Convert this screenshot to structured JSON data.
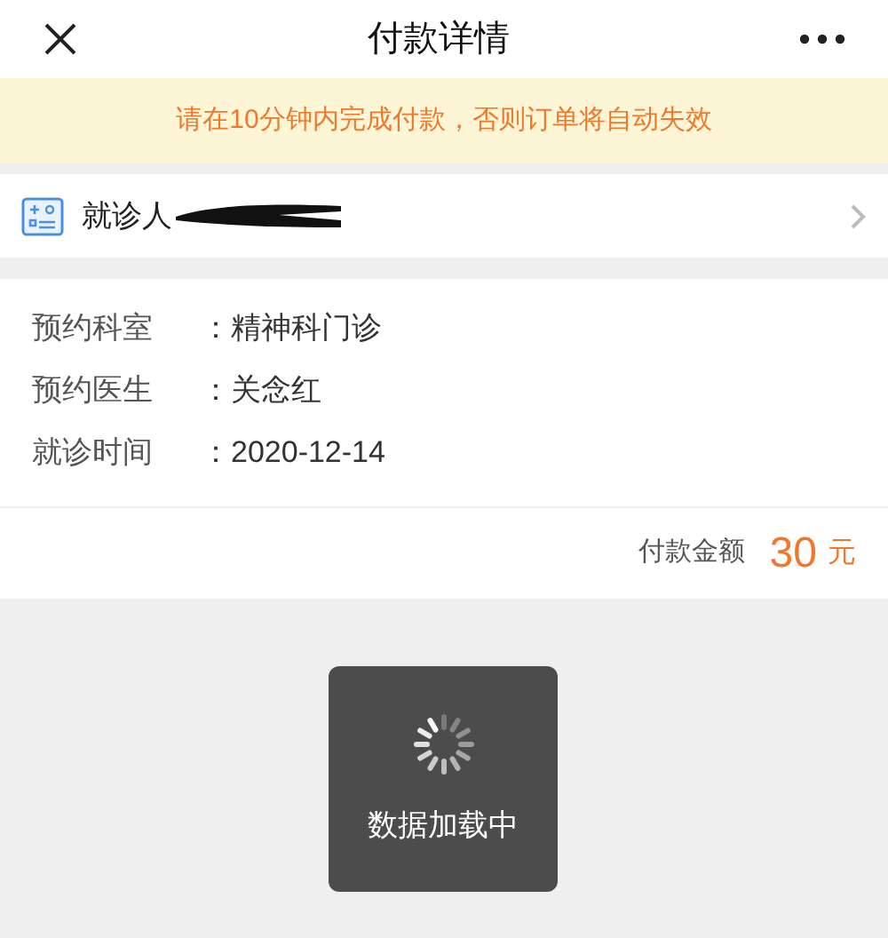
{
  "window": {
    "title": "付款详情"
  },
  "notice": "请在10分钟内完成付款，否则订单将自动失效",
  "patient": {
    "label": "就诊人"
  },
  "details": [
    {
      "label": "预约科室",
      "value": "：精神科门诊"
    },
    {
      "label": "预约医生",
      "value": "：关念红"
    },
    {
      "label": "就诊时间",
      "value": "：2020-12-14"
    }
  ],
  "amount": {
    "label": "付款金额",
    "value": "30",
    "unit": "元"
  },
  "loading": {
    "text": "数据加载中"
  }
}
